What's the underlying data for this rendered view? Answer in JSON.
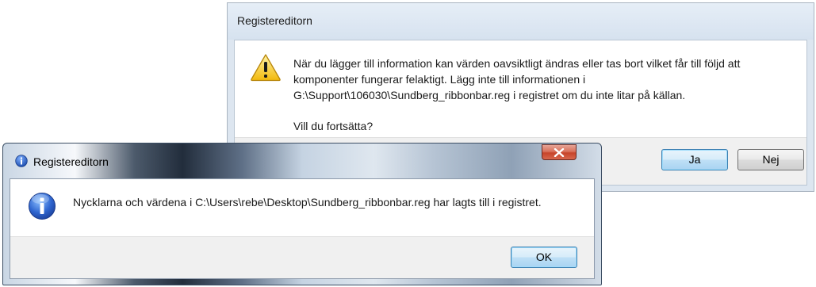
{
  "warning_dialog": {
    "title": "Registereditorn",
    "message": "När du lägger till information kan värden oavsiktligt ändras eller tas bort vilket får till följd att komponenter fungerar felaktigt. Lägg inte till informationen i G:\\Support\\106030\\Sundberg_ribbonbar.reg i registret om du inte litar på källan.",
    "question": "Vill du fortsätta?",
    "buttons": {
      "yes": "Ja",
      "no": "Nej"
    },
    "icon": "warning-icon"
  },
  "info_dialog": {
    "title": "Registereditorn",
    "message": "Nycklarna och värdena i C:\\Users\\rebe\\Desktop\\Sundberg_ribbonbar.reg har lagts till i registret.",
    "buttons": {
      "ok": "OK"
    },
    "icon": "info-icon"
  },
  "colors": {
    "default_button_border": "#3c7fb1",
    "close_button": "#c7442a",
    "info_blue": "#2a5bbf",
    "warning_yellow": "#f5c518"
  }
}
